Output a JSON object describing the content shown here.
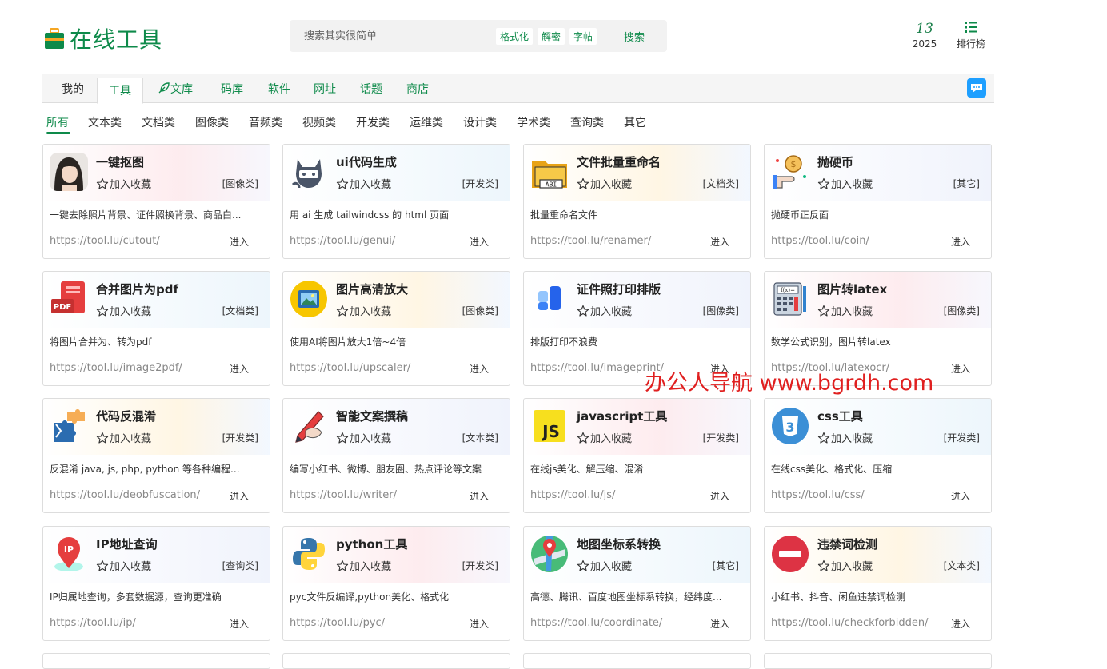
{
  "header": {
    "logo_text": "在线工具",
    "search_placeholder": "搜索其实很简单",
    "search_tags": [
      "格式化",
      "解密",
      "字帖"
    ],
    "search_button": "搜索",
    "date_day": "13",
    "date_year": "2025",
    "rank_label": "排行榜"
  },
  "main_nav": {
    "tabs": [
      {
        "label": "我的"
      },
      {
        "label": "工具"
      },
      {
        "label": "文库"
      },
      {
        "label": "码库"
      },
      {
        "label": "软件"
      },
      {
        "label": "网址"
      },
      {
        "label": "话题"
      },
      {
        "label": "商店"
      }
    ],
    "active": "工具"
  },
  "categories": [
    "所有",
    "文本类",
    "文档类",
    "图像类",
    "音频类",
    "视频类",
    "开发类",
    "运维类",
    "设计类",
    "学术类",
    "查询类",
    "其它"
  ],
  "active_category": "所有",
  "fav_label": "加入收藏",
  "enter_label": "进入",
  "tools": [
    {
      "title": "一键抠图",
      "category": "[图像类]",
      "desc": "一键去除照片背景、证件照换背景、商品白...",
      "url": "https://tool.lu/cutout/",
      "icon": "portrait-icon"
    },
    {
      "title": "ui代码生成",
      "category": "[开发类]",
      "desc": "用 ai 生成 tailwindcss 的 html 页面",
      "url": "https://tool.lu/genui/",
      "icon": "octocat-icon"
    },
    {
      "title": "文件批量重命名",
      "category": "[文档类]",
      "desc": "批量重命名文件",
      "url": "https://tool.lu/renamer/",
      "icon": "folder-abi-icon"
    },
    {
      "title": "抛硬币",
      "category": "[其它]",
      "desc": "抛硬币正反面",
      "url": "https://tool.lu/coin/",
      "icon": "coin-hand-icon"
    },
    {
      "title": "合并图片为pdf",
      "category": "[文档类]",
      "desc": "将图片合并为、转为pdf",
      "url": "https://tool.lu/image2pdf/",
      "icon": "pdf-icon"
    },
    {
      "title": "图片高清放大",
      "category": "[图像类]",
      "desc": "使用AI将图片放大1倍~4倍",
      "url": "https://tool.lu/upscaler/",
      "icon": "picture-icon"
    },
    {
      "title": "证件照打印排版",
      "category": "[图像类]",
      "desc": "排版打印不浪费",
      "url": "https://tool.lu/imageprint/",
      "icon": "layout-blocks-icon"
    },
    {
      "title": "图片转latex",
      "category": "[图像类]",
      "desc": "数学公式识别，图片转latex",
      "url": "https://tool.lu/latexocr/",
      "icon": "calculator-icon"
    },
    {
      "title": "代码反混淆",
      "category": "[开发类]",
      "desc": "反混淆 java, js, php, python 等各种编程...",
      "url": "https://tool.lu/deobfuscation/",
      "icon": "puzzle-icon"
    },
    {
      "title": "智能文案撰稿",
      "category": "[文本类]",
      "desc": "编写小红书、微博、朋友圈、热点评论等文案",
      "url": "https://tool.lu/writer/",
      "icon": "pen-hand-icon"
    },
    {
      "title": "javascript工具",
      "category": "[开发类]",
      "desc": "在线js美化、解压缩、混淆",
      "url": "https://tool.lu/js/",
      "icon": "js-icon"
    },
    {
      "title": "css工具",
      "category": "[开发类]",
      "desc": "在线css美化、格式化、压缩",
      "url": "https://tool.lu/css/",
      "icon": "css3-icon"
    },
    {
      "title": "IP地址查询",
      "category": "[查询类]",
      "desc": "IP归属地查询，多套数据源，查询更准确",
      "url": "https://tool.lu/ip/",
      "icon": "ip-pin-icon"
    },
    {
      "title": "python工具",
      "category": "[开发类]",
      "desc": "pyc文件反编译,python美化、格式化",
      "url": "https://tool.lu/pyc/",
      "icon": "python-icon"
    },
    {
      "title": "地图坐标系转换",
      "category": "[其它]",
      "desc": "高德、腾讯、百度地图坐标系转换，经纬度...",
      "url": "https://tool.lu/coordinate/",
      "icon": "map-icon"
    },
    {
      "title": "违禁词检测",
      "category": "[文本类]",
      "desc": "小红书、抖音、闲鱼违禁词检测",
      "url": "https://tool.lu/checkforbidden/",
      "icon": "no-entry-icon"
    }
  ],
  "watermark": "办公人导航 www.bgrdh.com",
  "colors": {
    "brand": "#0e8a4a",
    "accent_blue": "#1e9fff",
    "watermark": "#e02020"
  }
}
